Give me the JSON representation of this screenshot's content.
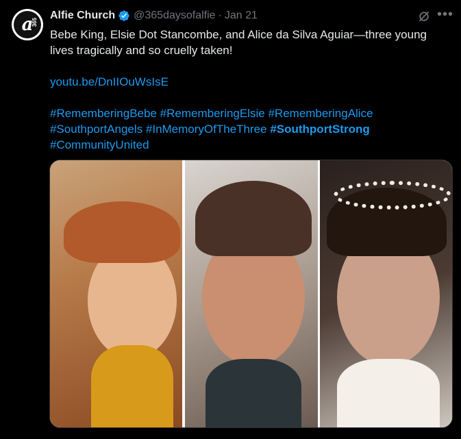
{
  "tweet": {
    "author_name": "Alfie Church",
    "handle": "@365daysofalfie",
    "separator": "·",
    "date": "Jan 21",
    "text_line": "Bebe King, Elsie Dot Stancombe, and Alice da Silva Aguiar—three young lives tragically and so cruelly taken!",
    "link": "youtu.be/DnIIOuWsIsE",
    "hashtags": [
      "#RememberingBebe",
      "#RememberingElsie",
      "#RememberingAlice",
      "#SouthportAngels",
      "#InMemoryOfTheThree",
      "#SouthportStrong",
      "#CommunityUnited"
    ]
  },
  "avatar": {
    "letter": "a",
    "number": "365"
  },
  "icons": {
    "verified": "verified-badge-icon",
    "grok": "grok-icon",
    "more": "more-icon"
  },
  "colors": {
    "accent": "#1d9bf0",
    "muted": "#71767b",
    "text": "#e7e9ea",
    "background": "#000000"
  }
}
